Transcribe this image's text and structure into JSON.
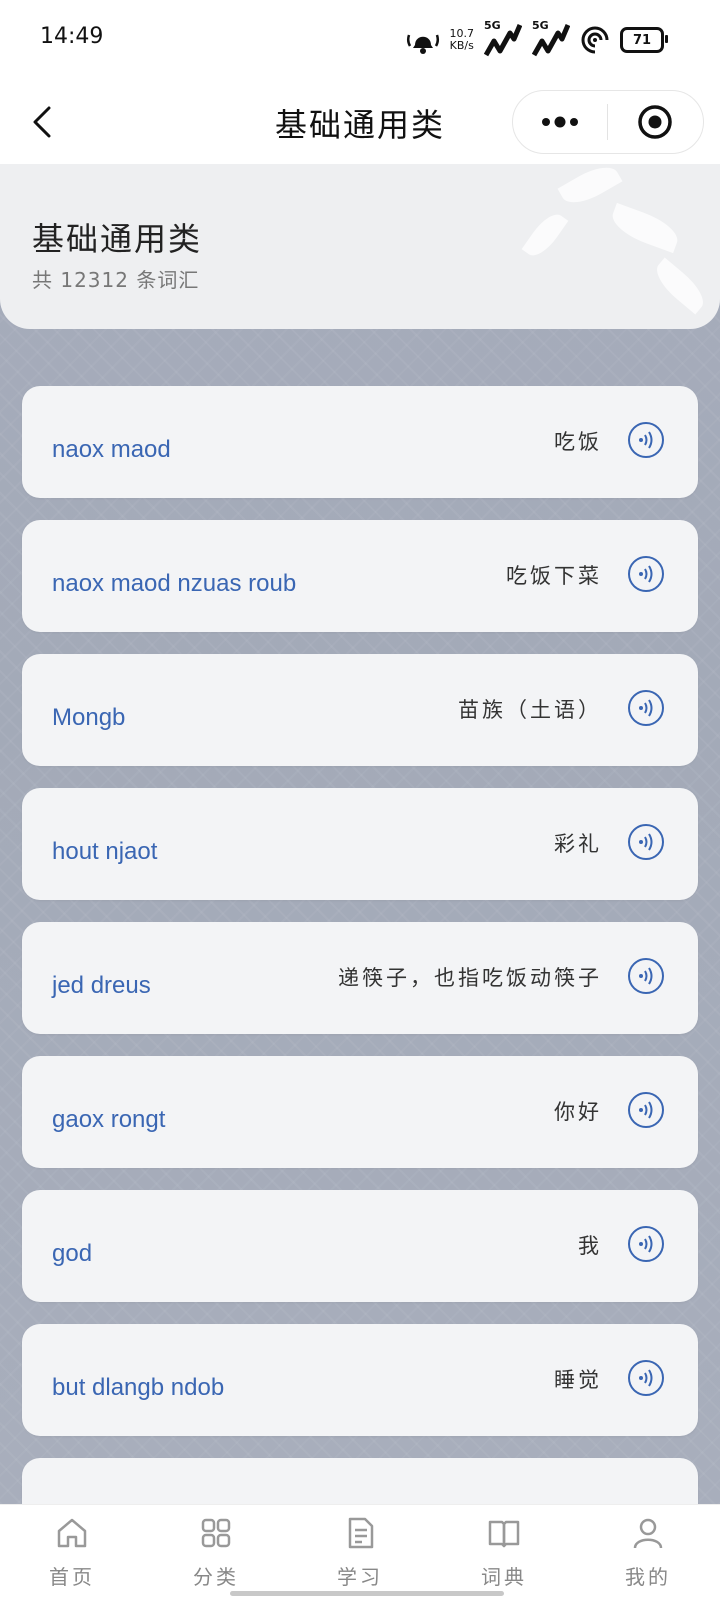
{
  "status_bar": {
    "time": "14:49",
    "net_speed_value": "10.7",
    "net_speed_unit": "KB/s",
    "sim1": "5G",
    "sim2": "5G",
    "battery": "71",
    "icons": [
      "alarm-icon",
      "signal-5g-icon",
      "signal-5g-icon",
      "hotspot-icon",
      "battery-icon"
    ]
  },
  "nav": {
    "title": "基础通用类",
    "icons": [
      "back-chevron-icon",
      "more-dots-icon",
      "close-target-icon"
    ]
  },
  "header": {
    "title": "基础通用类",
    "count_text": "共 12312 条词汇"
  },
  "words": [
    {
      "word": "naox maod",
      "meaning": "吃饭"
    },
    {
      "word": "naox maod nzuas roub",
      "meaning": "吃饭下菜"
    },
    {
      "word": "Mongb",
      "meaning": "苗族（土语）"
    },
    {
      "word": "hout njaot",
      "meaning": "彩礼"
    },
    {
      "word": "jed dreus",
      "meaning": "递筷子，也指吃饭动筷子"
    },
    {
      "word": "gaox rongt",
      "meaning": "你好"
    },
    {
      "word": "god",
      "meaning": "我"
    },
    {
      "word": "but dlangb ndob",
      "meaning": "睡觉"
    }
  ],
  "tabs": [
    {
      "label": "首页",
      "icon": "home-icon"
    },
    {
      "label": "分类",
      "icon": "grid-icon"
    },
    {
      "label": "学习",
      "icon": "document-icon"
    },
    {
      "label": "词典",
      "icon": "book-icon"
    },
    {
      "label": "我的",
      "icon": "user-icon"
    }
  ],
  "colors": {
    "accent": "#3a66b3",
    "card_bg": "#f3f4f6",
    "page_bg": "#a6acbb"
  }
}
